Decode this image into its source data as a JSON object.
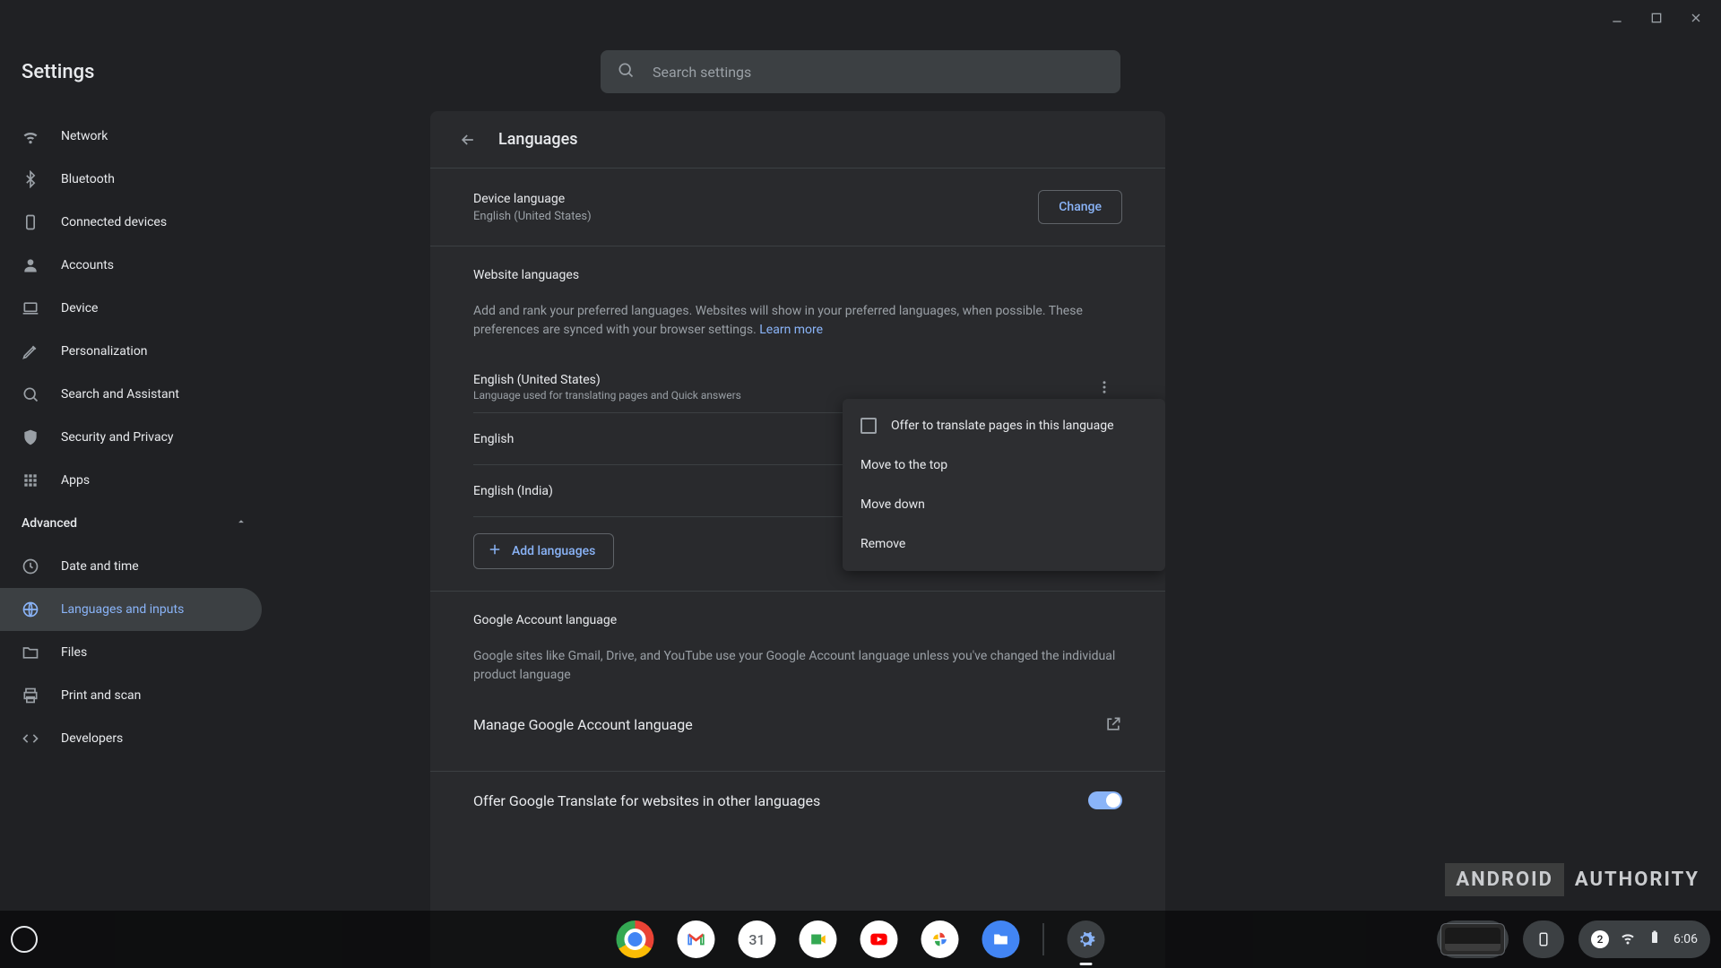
{
  "app_title": "Settings",
  "search": {
    "placeholder": "Search settings"
  },
  "sidebar": {
    "items": [
      {
        "label": "Network"
      },
      {
        "label": "Bluetooth"
      },
      {
        "label": "Connected devices"
      },
      {
        "label": "Accounts"
      },
      {
        "label": "Device"
      },
      {
        "label": "Personalization"
      },
      {
        "label": "Search and Assistant"
      },
      {
        "label": "Security and Privacy"
      },
      {
        "label": "Apps"
      }
    ],
    "advanced_label": "Advanced",
    "advanced_items": [
      {
        "label": "Date and time"
      },
      {
        "label": "Languages and inputs"
      },
      {
        "label": "Files"
      },
      {
        "label": "Print and scan"
      },
      {
        "label": "Developers"
      }
    ]
  },
  "page": {
    "title": "Languages",
    "device_language": {
      "heading": "Device language",
      "value": "English (United States)",
      "change_label": "Change"
    },
    "website": {
      "heading": "Website languages",
      "description": "Add and rank your preferred languages. Websites will show in your preferred languages, when possible. These preferences are synced with your browser settings.",
      "learn_more": "Learn more",
      "languages": [
        {
          "name": "English (United States)",
          "sub": "Language used for translating pages and Quick answers"
        },
        {
          "name": "English",
          "sub": ""
        },
        {
          "name": "English (India)",
          "sub": ""
        }
      ],
      "add_label": "Add languages"
    },
    "google_account": {
      "heading": "Google Account language",
      "description": "Google sites like Gmail, Drive, and YouTube use your Google Account language unless you've changed the individual product language",
      "manage_label": "Manage Google Account language"
    },
    "translate_toggle": {
      "label": "Offer Google Translate for websites in other languages",
      "on": true
    }
  },
  "context_menu": {
    "offer_translate": "Offer to translate pages in this language",
    "move_top": "Move to the top",
    "move_down": "Move down",
    "remove": "Remove"
  },
  "shelf": {
    "calendar_day": "31",
    "notification_count": "2",
    "clock": "6:06"
  },
  "watermark": {
    "left": "ANDROID",
    "right": "AUTHORITY"
  }
}
